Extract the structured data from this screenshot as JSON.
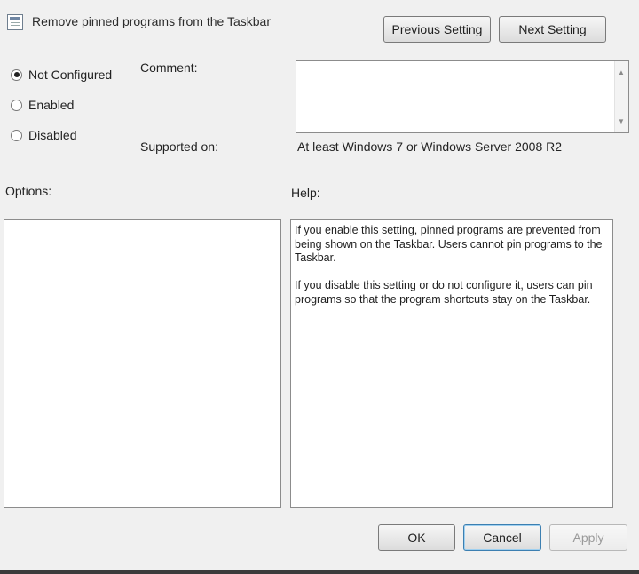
{
  "title": "Remove pinned programs from the Taskbar",
  "nav": {
    "previous": "Previous Setting",
    "next": "Next Setting"
  },
  "state": {
    "options": [
      {
        "label": "Not Configured",
        "checked": true
      },
      {
        "label": "Enabled",
        "checked": false
      },
      {
        "label": "Disabled",
        "checked": false
      }
    ]
  },
  "comment": {
    "label": "Comment:",
    "value": ""
  },
  "supported": {
    "label": "Supported on:",
    "value": "At least Windows 7 or Windows Server 2008 R2"
  },
  "options_panel": {
    "label": "Options:"
  },
  "help_panel": {
    "label": "Help:",
    "text": "If you enable this setting, pinned programs are prevented from being shown on the Taskbar. Users cannot pin programs to the Taskbar.\n\nIf you disable this setting or do not configure it, users can pin programs so that the program shortcuts stay on the Taskbar."
  },
  "buttons": {
    "ok": "OK",
    "cancel": "Cancel",
    "apply": "Apply"
  }
}
